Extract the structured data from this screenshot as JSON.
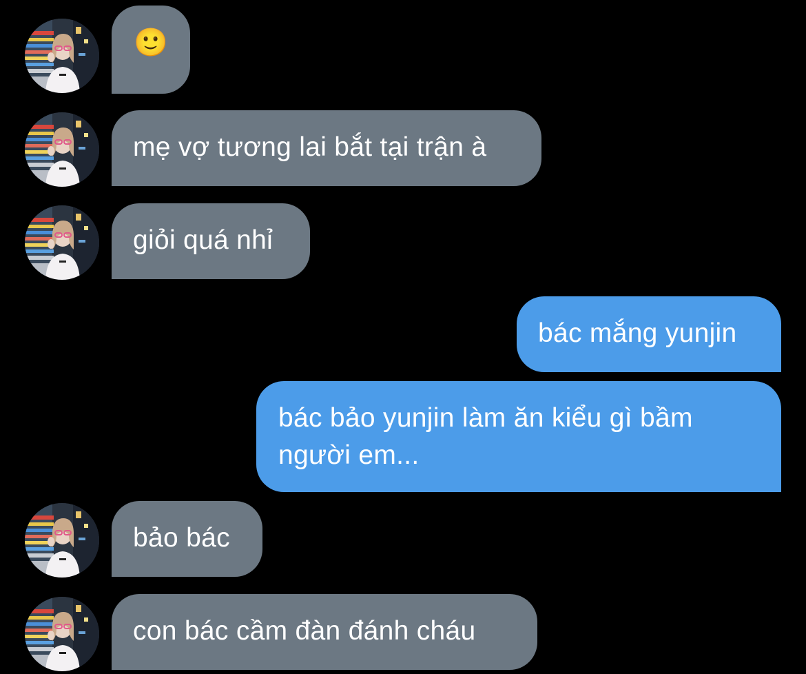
{
  "colors": {
    "background": "#000000",
    "incoming_bubble": "#6c7883",
    "outgoing_bubble": "#4c9ce9",
    "text": "#ffffff"
  },
  "messages": [
    {
      "direction": "incoming",
      "text": "🙂",
      "avatar": "contact-avatar-photo"
    },
    {
      "direction": "incoming",
      "text": "mẹ vợ tương lai bắt tại trận à",
      "avatar": "contact-avatar-photo"
    },
    {
      "direction": "incoming",
      "text": "giỏi quá nhỉ",
      "avatar": "contact-avatar-photo"
    },
    {
      "direction": "outgoing",
      "text": "bác mắng yunjin"
    },
    {
      "direction": "outgoing",
      "text": "bác bảo yunjin làm ăn kiểu gì bầm người em..."
    },
    {
      "direction": "incoming",
      "text": "bảo bác",
      "avatar": "contact-avatar-photo"
    },
    {
      "direction": "incoming",
      "text": "con bác cầm đàn đánh cháu",
      "avatar": "contact-avatar-photo"
    }
  ]
}
